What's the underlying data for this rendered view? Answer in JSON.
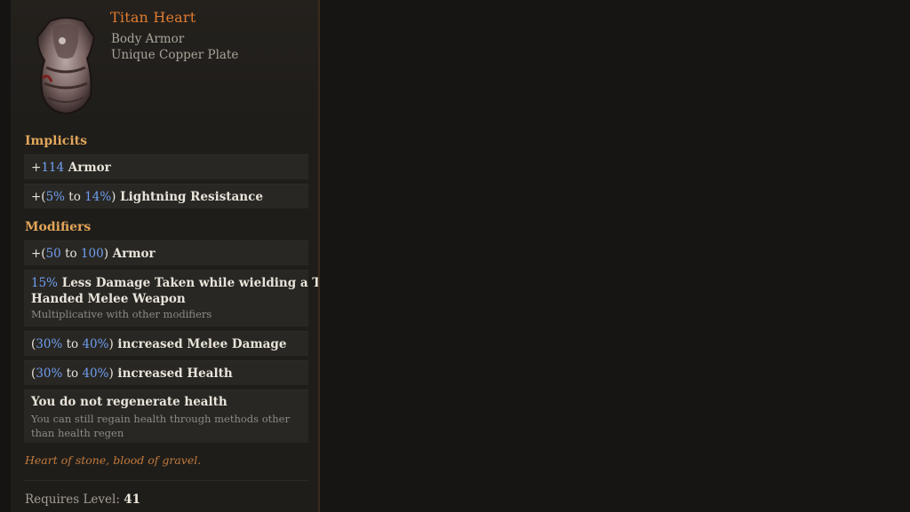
{
  "item": {
    "name": "Titan Heart",
    "type": "Body Armor",
    "base": "Unique Copper Plate"
  },
  "implicits": {
    "title": "Implicits",
    "mods": [
      {
        "prefix": "+",
        "value": "114",
        "text": " Armor"
      },
      {
        "prefix": "+(",
        "min": "5%",
        "to": " to ",
        "max": "14%",
        "close": ")",
        "text": " Lightning Resistance"
      }
    ]
  },
  "modifiers": {
    "title": "Modifiers",
    "mods": [
      {
        "prefix": "+(",
        "min": "50",
        "to": " to ",
        "max": "100",
        "close": ")",
        "text": " Armor"
      },
      {
        "value": "15%",
        "text_line1": " Less Damage Taken while wielding a Two",
        "text_line2": "Handed Melee Weapon",
        "sub": "Multiplicative with other modifiers"
      },
      {
        "prefix": "(",
        "min": "30%",
        "to": " to ",
        "max": "40%",
        "close": ")",
        "text": " increased Melee Damage"
      },
      {
        "prefix": "(",
        "min": "30%",
        "to": " to ",
        "max": "40%",
        "close": ")",
        "text": " increased Health"
      },
      {
        "text": "You do not regenerate health",
        "sub_line1": "You can still regain health through methods other",
        "sub_line2": "than health regen"
      }
    ]
  },
  "flavor_text": "Heart of stone, blood of gravel.",
  "requirements": {
    "label": "Requires Level: ",
    "level": "41"
  },
  "colors": {
    "name": "#e07b2e",
    "section": "#e2a65a",
    "number": "#6f9ff0",
    "flavor": "#c17a3c"
  },
  "icons": {
    "item_image": "copper-plate-armor-icon"
  }
}
